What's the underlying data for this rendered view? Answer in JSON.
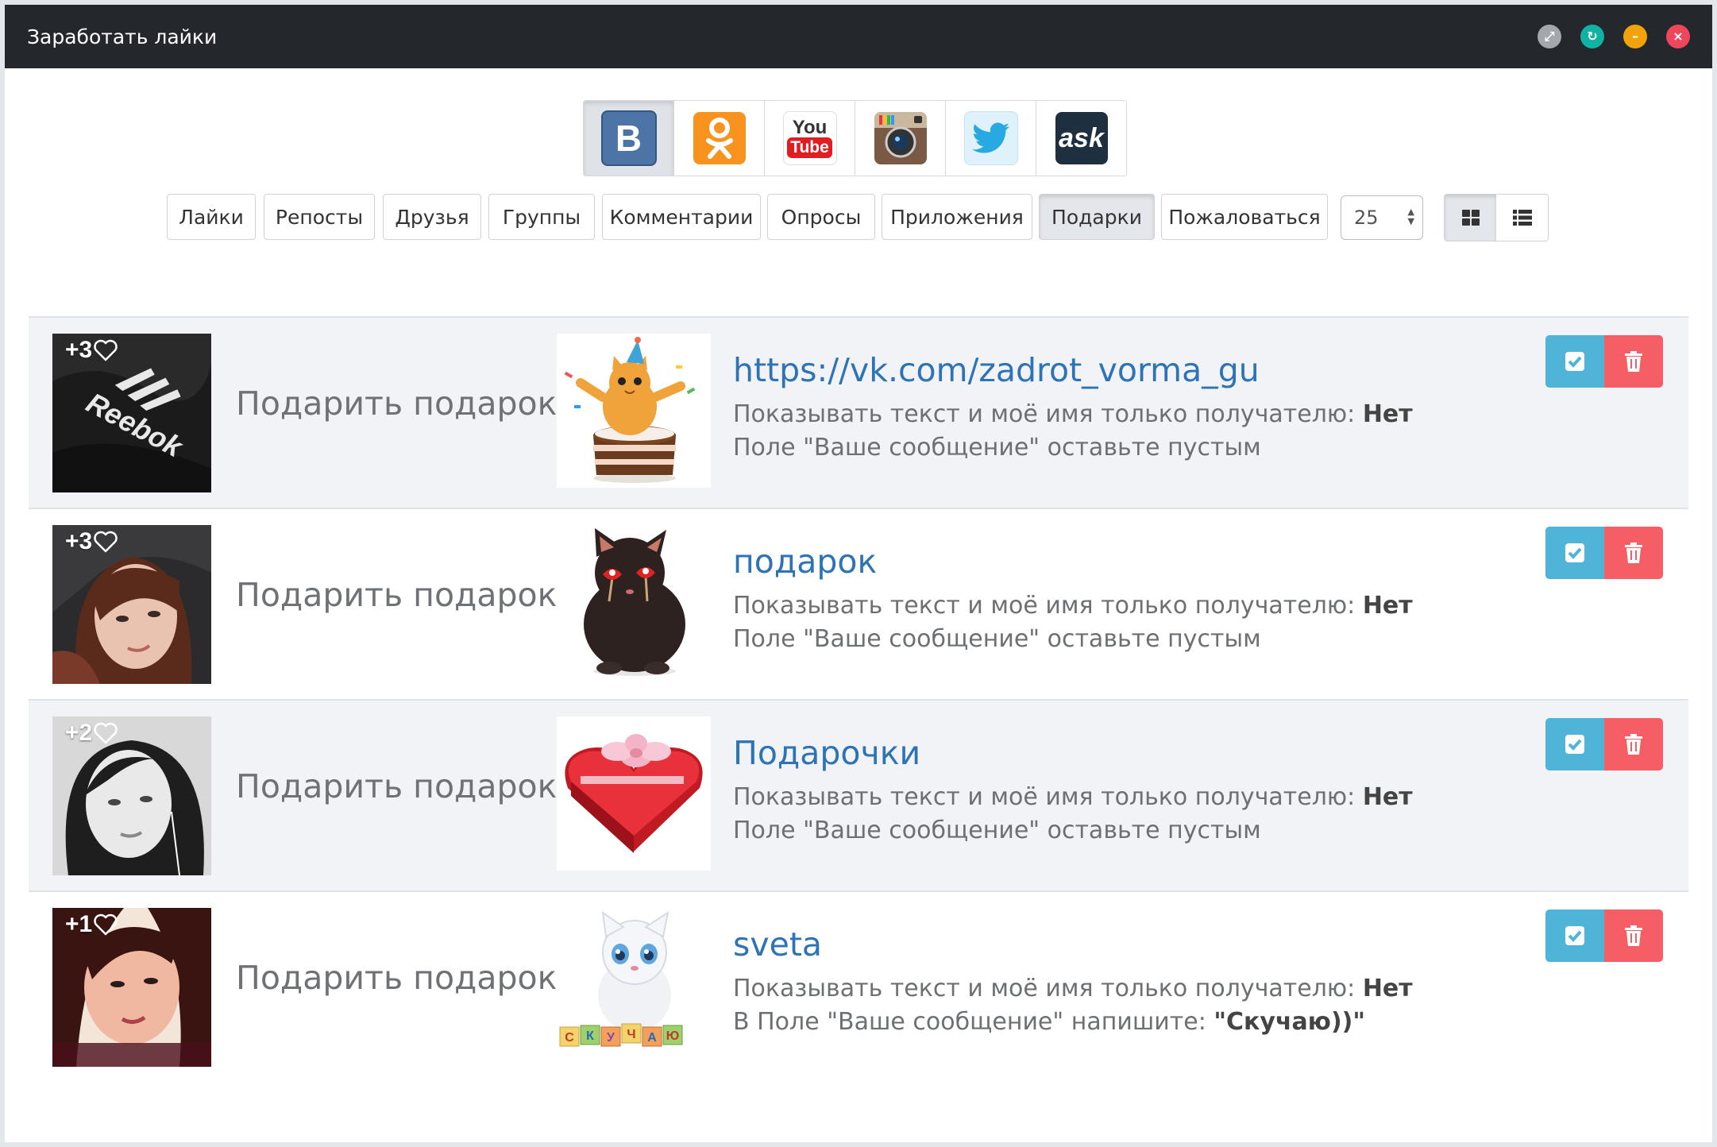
{
  "window": {
    "title": "Заработать лайки",
    "controls": [
      {
        "name": "expand",
        "color": "#a4a8ad",
        "glyph": "⤢"
      },
      {
        "name": "refresh",
        "color": "#11b2a4",
        "glyph": "↻"
      },
      {
        "name": "minimize",
        "color": "#f2a20a",
        "glyph": "–"
      },
      {
        "name": "close",
        "color": "#f0455a",
        "glyph": "×"
      }
    ]
  },
  "networks": [
    {
      "name": "vk-icon",
      "label": "В",
      "active": true
    },
    {
      "name": "odnoklassniki-icon",
      "label": "ок",
      "active": false
    },
    {
      "name": "youtube-icon",
      "label": "YouTube",
      "active": false
    },
    {
      "name": "instagram-icon",
      "label": "",
      "active": false
    },
    {
      "name": "twitter-icon",
      "label": "",
      "active": false
    },
    {
      "name": "ask-icon",
      "label": "ask",
      "active": false
    }
  ],
  "tabs": [
    {
      "label": "Лайки",
      "active": false
    },
    {
      "label": "Репосты",
      "active": false
    },
    {
      "label": "Друзья",
      "active": false
    },
    {
      "label": "Группы",
      "active": false
    },
    {
      "label": "Комментарии",
      "active": false
    },
    {
      "label": "Опросы",
      "active": false
    },
    {
      "label": "Приложения",
      "active": false
    },
    {
      "label": "Подарки",
      "active": true
    },
    {
      "label": "Пожаловаться",
      "active": false
    }
  ],
  "per_page": {
    "value": "25"
  },
  "view_mode": {
    "grid_active": true
  },
  "tasks": [
    {
      "likes": "+3",
      "label": "Подарить подарок:",
      "title": "https://vk.com/zadrot_vorma_gu",
      "line1_text": "Показывать текст и моё имя только получателю:",
      "line1_value": "Нет",
      "line2_text": "Поле \"Ваше сообщение\" оставьте пустым",
      "line2_value": ""
    },
    {
      "likes": "+3",
      "label": "Подарить подарок:",
      "title": "подарок",
      "line1_text": "Показывать текст и моё имя только получателю:",
      "line1_value": "Нет",
      "line2_text": "Поле \"Ваше сообщение\" оставьте пустым",
      "line2_value": ""
    },
    {
      "likes": "+2",
      "label": "Подарить подарок:",
      "title": "Подарочки",
      "line1_text": "Показывать текст и моё имя только получателю:",
      "line1_value": "Нет",
      "line2_text": "Поле \"Ваше сообщение\" оставьте пустым",
      "line2_value": ""
    },
    {
      "likes": "+1",
      "label": "Подарить подарок:",
      "title": "sveta",
      "line1_text": "Показывать текст и моё имя только получателю:",
      "line1_value": "Нет",
      "line2_text": "В Поле \"Ваше сообщение\" напишите:",
      "line2_value": "\"Скучаю))\""
    }
  ],
  "gift_block_text": "СКУЧАЮ"
}
